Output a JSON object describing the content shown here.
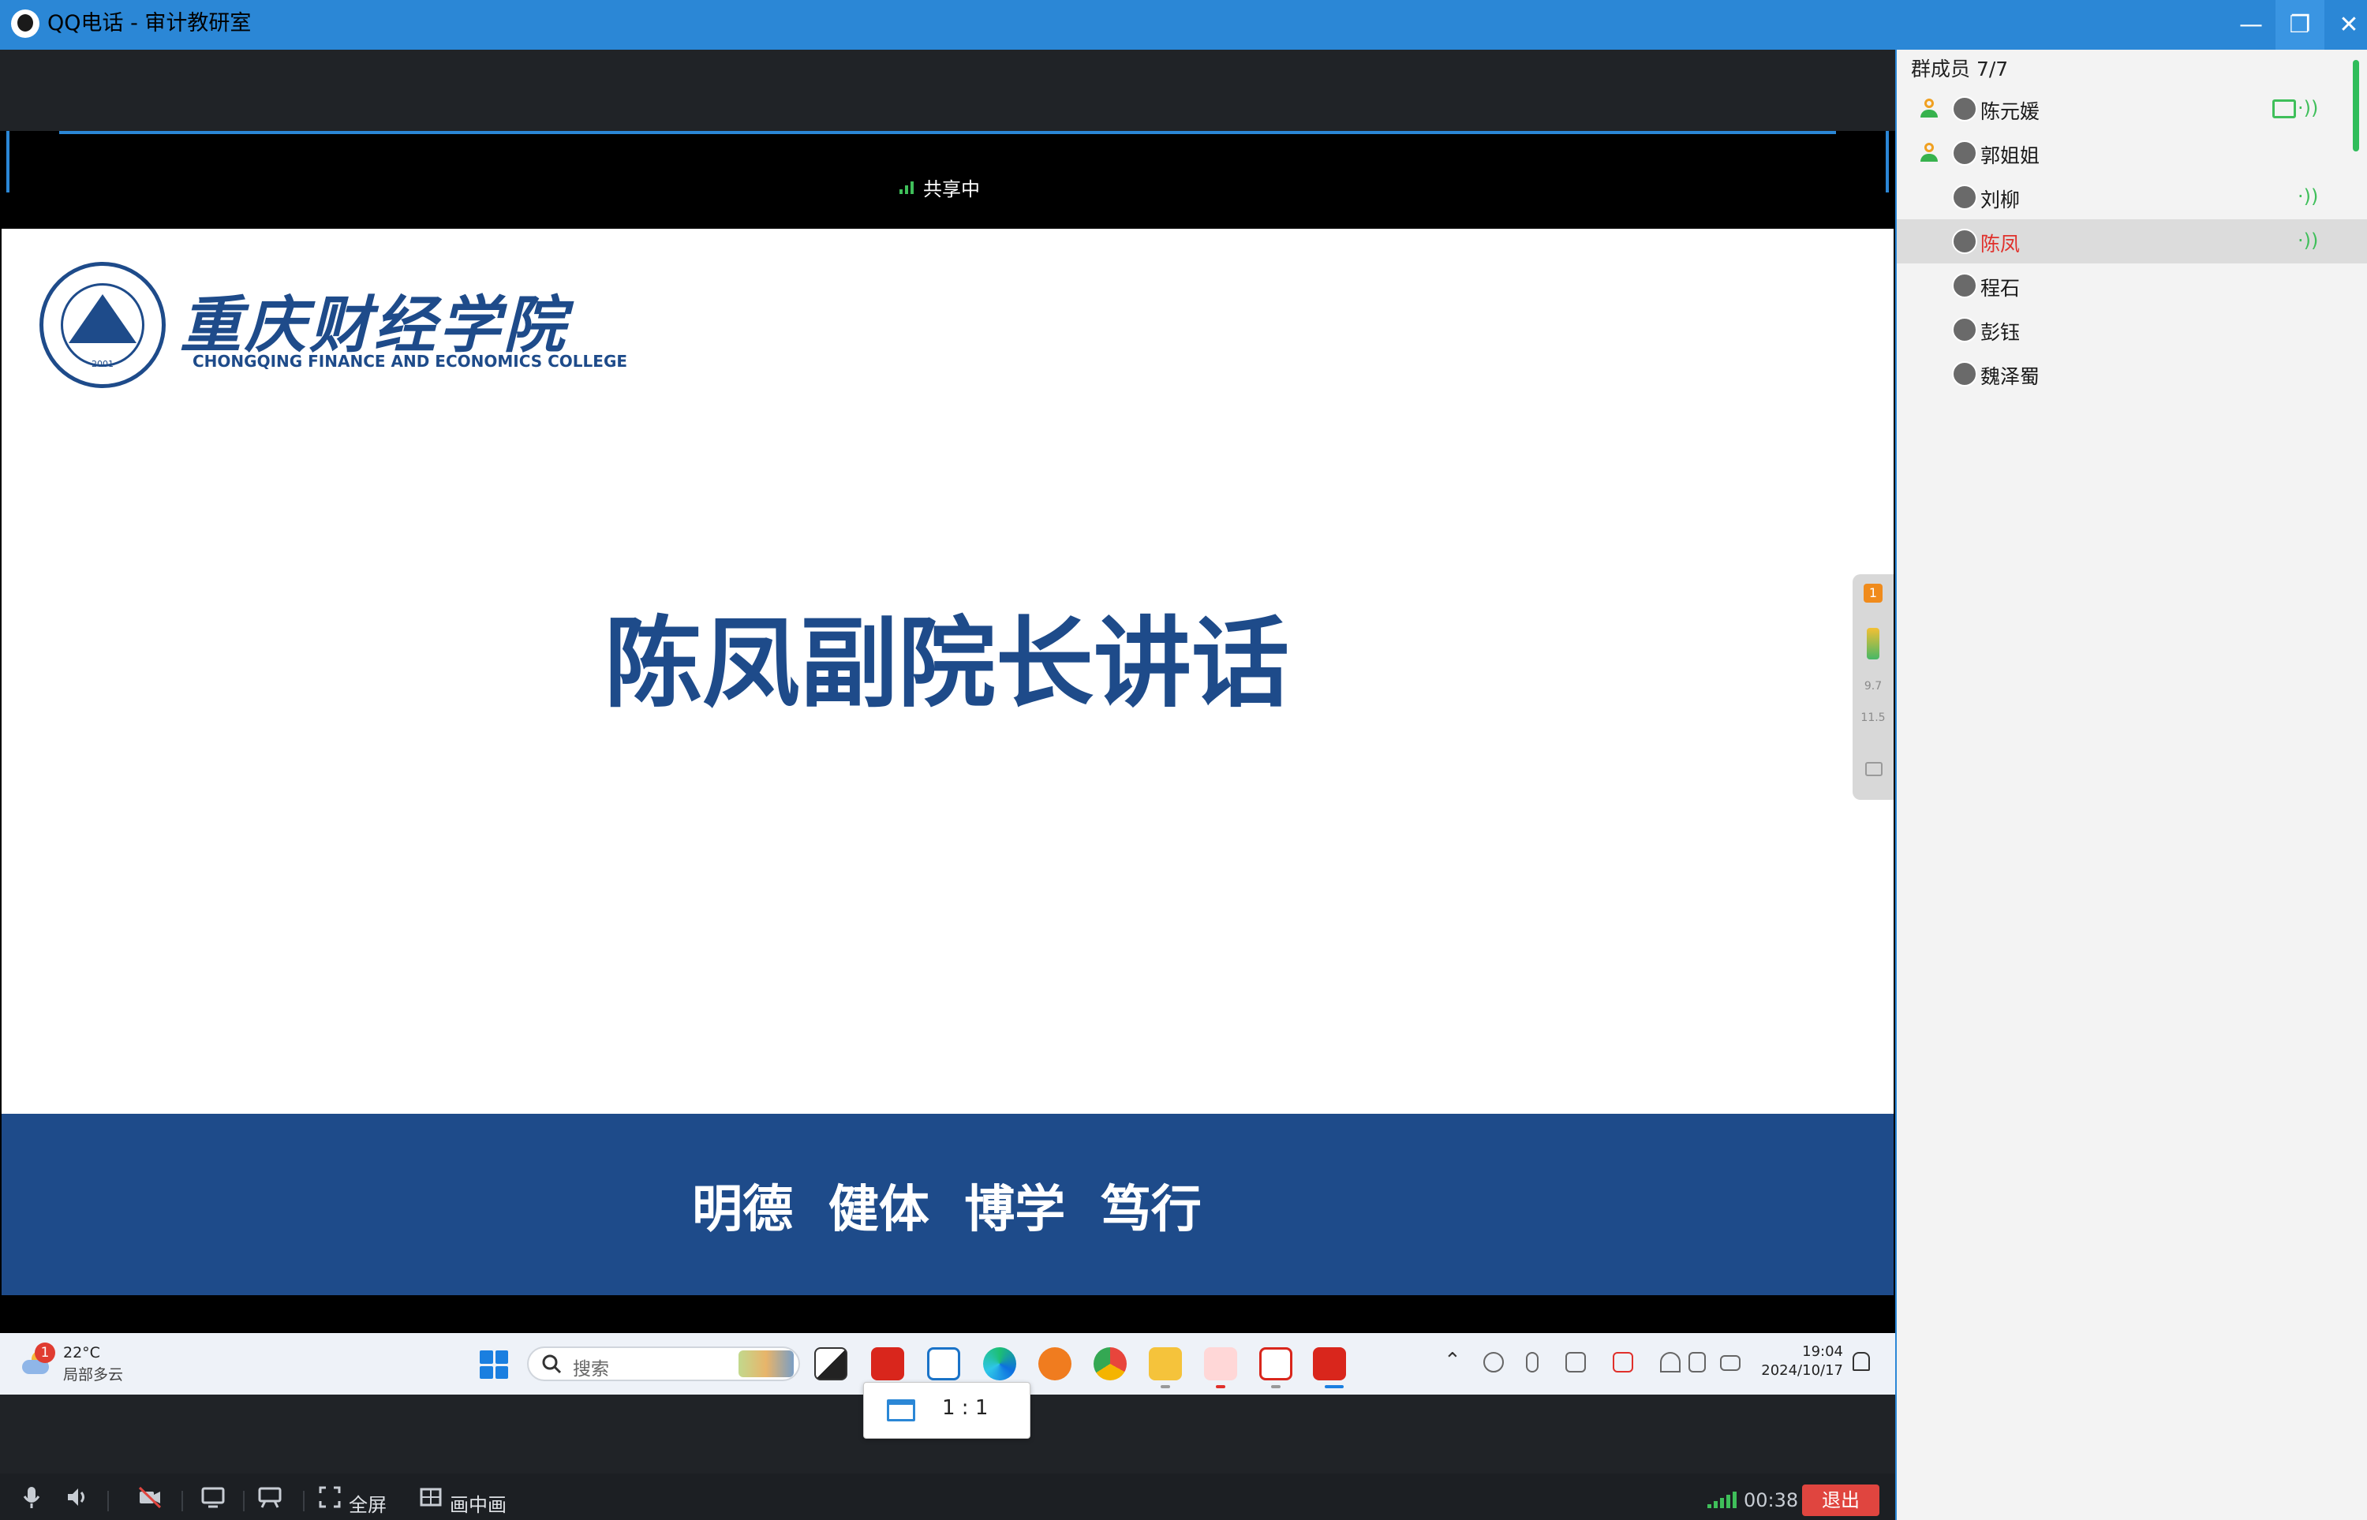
{
  "window": {
    "title": "QQ电话 - 审计教研室",
    "minimize_icon": "minimize-icon",
    "restore_icon": "restore-icon",
    "close_icon": "close-icon",
    "titlebar_color": "#2b87d6"
  },
  "share": {
    "status": "共享中"
  },
  "slide": {
    "college_cn": "重庆财经学院",
    "college_en": "CHONGQING FINANCE AND ECONOMICS COLLEGE",
    "seal_year": "2001",
    "title": "陈凤副院长讲话",
    "motto": "明德  健体  博学  笃行",
    "brand_color": "#1e4b8a"
  },
  "stats": {
    "badge": "1",
    "upload": "9.7",
    "download": "11.5"
  },
  "remote_taskbar": {
    "weather_badge": "1",
    "temperature": "22°C",
    "weather": "局部多云",
    "search_placeholder": "搜索",
    "time": "19:04",
    "date": "2024/10/17"
  },
  "ratio_popup": {
    "label": "1 : 1"
  },
  "controls": {
    "fullscreen": "全屏",
    "pip": "画中画",
    "timer": "00:38",
    "exit": "退出"
  },
  "members": {
    "header": "群成员 7/7",
    "list": [
      {
        "name": "陈元媛",
        "host": true,
        "sharing": true,
        "speaking": true
      },
      {
        "name": "郭姐姐",
        "host": true,
        "sharing": false,
        "speaking": false
      },
      {
        "name": "刘柳",
        "host": false,
        "sharing": false,
        "speaking": true
      },
      {
        "name": "陈凤",
        "host": false,
        "sharing": false,
        "speaking": true,
        "selected": true
      },
      {
        "name": "程石",
        "host": false,
        "sharing": false,
        "speaking": false
      },
      {
        "name": "彭钰",
        "host": false,
        "sharing": false,
        "speaking": false
      },
      {
        "name": "魏泽蜀",
        "host": false,
        "sharing": false,
        "speaking": false
      }
    ]
  }
}
